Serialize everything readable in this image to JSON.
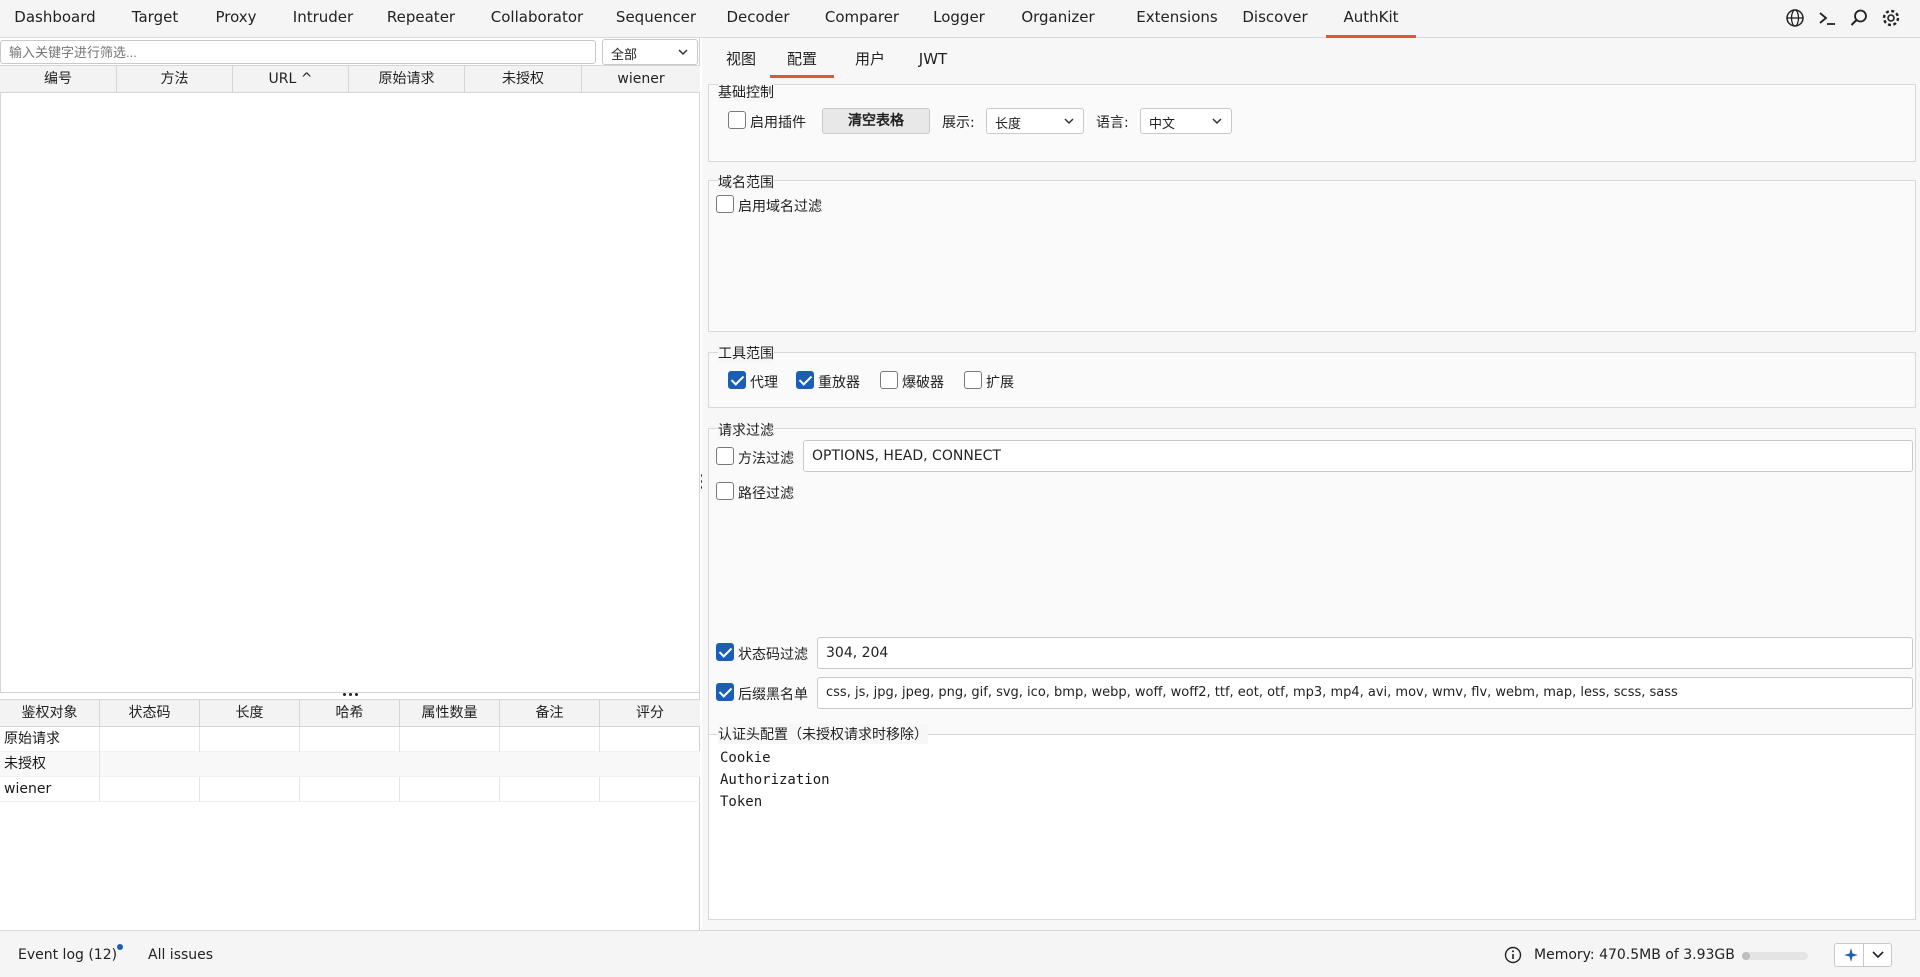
{
  "topnav": {
    "tabs": [
      "Dashboard",
      "Target",
      "Proxy",
      "Intruder",
      "Repeater",
      "Collaborator",
      "Sequencer",
      "Decoder",
      "Comparer",
      "Logger",
      "Organizer",
      "Extensions",
      "Discover",
      "AuthKit"
    ],
    "active": "AuthKit",
    "icons": [
      "globe-icon",
      "terminal-icon",
      "search-icon",
      "gear-icon"
    ]
  },
  "left": {
    "filter_placeholder": "输入关键字进行筛选...",
    "scope_select": "全部",
    "request_table": {
      "columns": [
        "编号",
        "方法",
        "URL ^",
        "原始请求",
        "未授权",
        "wiener"
      ],
      "rows": []
    },
    "auth_table": {
      "columns": [
        "鉴权对象",
        "状态码",
        "长度",
        "哈希",
        "属性数量",
        "备注",
        "评分"
      ],
      "rows": [
        "原始请求",
        "未授权",
        "wiener"
      ]
    }
  },
  "right": {
    "subtabs": [
      "视图",
      "配置",
      "用户",
      "JWT"
    ],
    "active_subtab": "配置",
    "basic": {
      "title": "基础控制",
      "enable_plugin": "启用插件",
      "clear_table": "清空表格",
      "display_label": "展示:",
      "display_value": "长度",
      "language_label": "语言:",
      "language_value": "中文"
    },
    "domain": {
      "title": "域名范围",
      "enable_filter": "启用域名过滤"
    },
    "tools": {
      "title": "工具范围",
      "items": [
        {
          "label": "代理",
          "checked": true
        },
        {
          "label": "重放器",
          "checked": true
        },
        {
          "label": "爆破器",
          "checked": false
        },
        {
          "label": "扩展",
          "checked": false
        }
      ]
    },
    "request_filter": {
      "title": "请求过滤",
      "method_filter": "方法过滤",
      "method_value": "OPTIONS, HEAD, CONNECT",
      "path_filter": "路径过滤",
      "status_filter": "状态码过滤",
      "status_value": "304, 204",
      "suffix_blacklist": "后缀黑名单",
      "suffix_value": "css, js, jpg, jpeg, png, gif, svg, ico, bmp, webp, woff, woff2, ttf, eot, otf, mp3, mp4, avi, mov, wmv, flv, webm, map, less, scss, sass"
    },
    "auth_headers": {
      "title": "认证头配置（未授权请求时移除）",
      "lines": [
        "Cookie",
        "Authorization",
        "Token"
      ]
    }
  },
  "bottom": {
    "event_log": "Event log (12)",
    "all_issues": "All issues",
    "memory": "Memory: 470.5MB of 3.93GB",
    "memory_fraction": 0.12,
    "colors": {
      "accent": "#e4572e",
      "checked": "#1a5fb4",
      "notify_dot": "#1a5fb4"
    }
  }
}
